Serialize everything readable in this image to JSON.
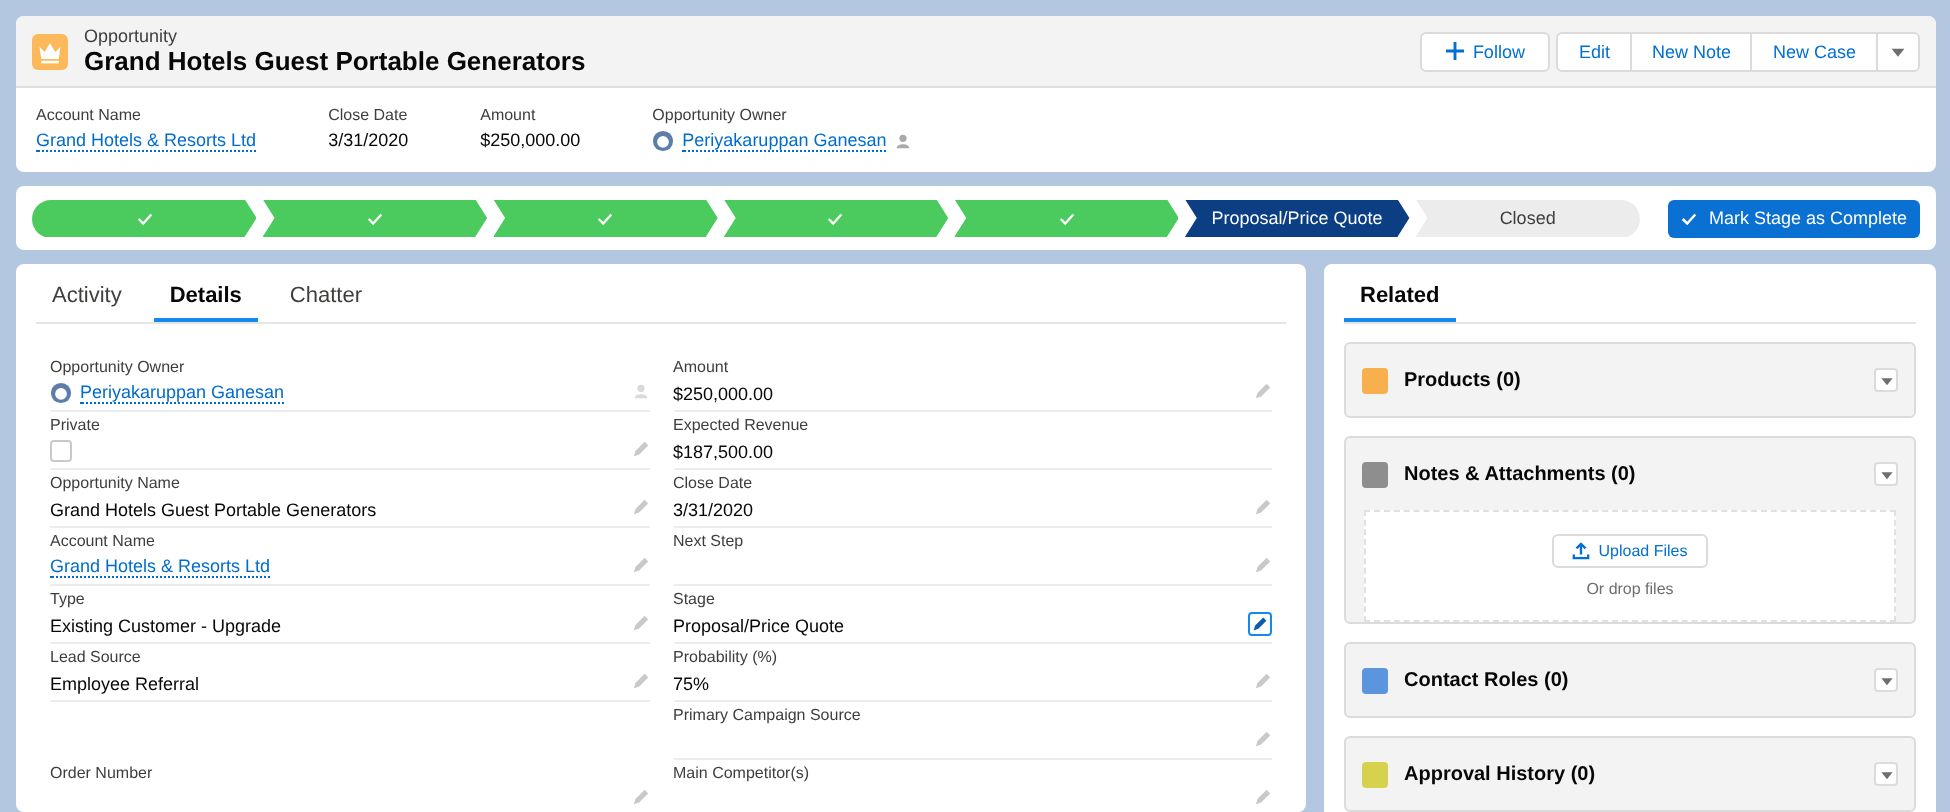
{
  "header": {
    "object_type": "Opportunity",
    "title": "Grand Hotels Guest Portable Generators",
    "follow_button": "Follow",
    "actions": [
      "Edit",
      "New Note",
      "New Case"
    ]
  },
  "highlights": [
    {
      "label": "Account Name",
      "value": "Grand Hotels & Resorts Ltd",
      "kind": "link"
    },
    {
      "label": "Close Date",
      "value": "3/31/2020",
      "kind": "text"
    },
    {
      "label": "Amount",
      "value": "$250,000.00",
      "kind": "text"
    },
    {
      "label": "Opportunity Owner",
      "value": "Periyakaruppan Ganesan",
      "kind": "owner"
    }
  ],
  "path": {
    "stages": [
      {
        "complete": true,
        "selected": false
      },
      {
        "complete": true,
        "selected": false
      },
      {
        "complete": true,
        "selected": false
      },
      {
        "complete": true,
        "selected": false
      },
      {
        "complete": true,
        "selected": false
      },
      {
        "complete": false,
        "selected": true,
        "label": "Proposal/Price Quote"
      },
      {
        "complete": false,
        "selected": false,
        "label": "Closed"
      }
    ],
    "button": "Mark Stage as Complete"
  },
  "tabs": [
    {
      "label": "Activity",
      "selected": false
    },
    {
      "label": "Details",
      "selected": true
    },
    {
      "label": "Chatter",
      "selected": false
    }
  ],
  "details": {
    "left": [
      {
        "label": "Opportunity Owner",
        "value": "Periyakaruppan Ganesan",
        "kind": "owner",
        "editable": true
      },
      {
        "label": "Private",
        "kind": "checkbox",
        "checked": false,
        "editable": true
      },
      {
        "label": "Opportunity Name",
        "value": "Grand Hotels Guest Portable Generators",
        "kind": "text",
        "editable": true
      },
      {
        "label": "Account Name",
        "value": "Grand Hotels & Resorts Ltd",
        "kind": "link",
        "editable": true
      },
      {
        "label": "Type",
        "value": "Existing Customer - Upgrade",
        "kind": "text",
        "editable": true
      },
      {
        "label": "Lead Source",
        "value": "Employee Referral",
        "kind": "text",
        "editable": true
      },
      {
        "kind": "blank"
      },
      {
        "label": "Order Number",
        "editable": true
      }
    ],
    "right": [
      {
        "label": "Amount",
        "value": "$250,000.00",
        "kind": "text",
        "editable": true
      },
      {
        "label": "Expected Revenue",
        "value": "$187,500.00",
        "kind": "text"
      },
      {
        "label": "Close Date",
        "value": "3/31/2020",
        "kind": "text",
        "editable": true
      },
      {
        "label": "Next Step",
        "editable": true
      },
      {
        "label": "Stage",
        "value": "Proposal/Price Quote",
        "kind": "text",
        "editable": true,
        "focused": true
      },
      {
        "label": "Probability (%)",
        "value": "75%",
        "kind": "text",
        "editable": true
      },
      {
        "label": "Primary Campaign Source",
        "editable": true
      },
      {
        "label": "Main Competitor(s)",
        "editable": true
      }
    ]
  },
  "related": {
    "tab": "Related",
    "cards": [
      {
        "title": "Products (0)",
        "color": "#f8b04c",
        "expanded": false
      },
      {
        "title": "Notes & Attachments (0)",
        "color": "#8e8e8e",
        "expanded": true,
        "upload_button": "Upload Files",
        "drop_text": "Or drop files"
      },
      {
        "title": "Contact Roles (0)",
        "color": "#5a95dd",
        "expanded": false
      },
      {
        "title": "Approval History (0)",
        "color": "#d6d24e",
        "expanded": false
      }
    ]
  }
}
